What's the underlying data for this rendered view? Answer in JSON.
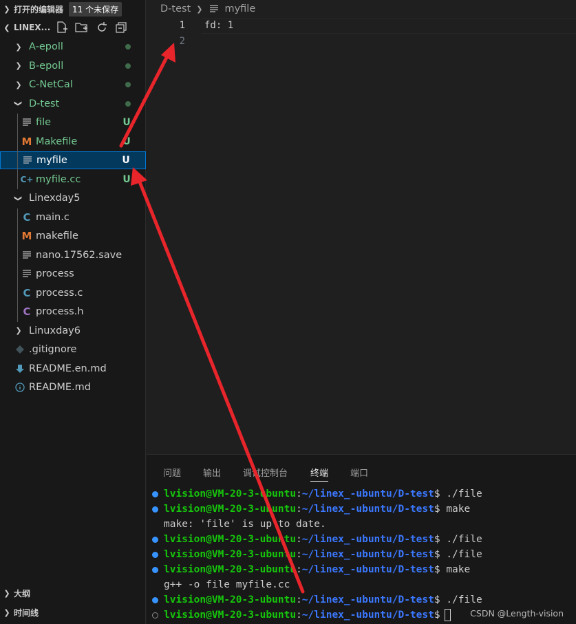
{
  "sidebar": {
    "open_editors": {
      "title": "打开的编辑器",
      "badge": "11 个未保存"
    },
    "workspace": {
      "title": "LINEX..."
    },
    "tree": [
      {
        "label": "A-epoll",
        "type": "folder",
        "status": "dot",
        "color": "#73c991"
      },
      {
        "label": "B-epoll",
        "type": "folder",
        "status": "dot",
        "color": "#73c991"
      },
      {
        "label": "C-NetCal",
        "type": "folder",
        "status": "dot",
        "color": "#73c991"
      },
      {
        "label": "D-test",
        "type": "folder-open",
        "status": "dot",
        "color": "#73c991"
      },
      {
        "label": "file",
        "type": "text-file",
        "status": "U",
        "color": "#73c991"
      },
      {
        "label": "Makefile",
        "type": "makefile",
        "status": "U",
        "color": "#73c991"
      },
      {
        "label": "myfile",
        "type": "text-file",
        "status": "U",
        "color": "#ffffff",
        "selected": true
      },
      {
        "label": "myfile.cc",
        "type": "cpp-file",
        "status": "U",
        "color": "#73c991"
      },
      {
        "label": "Linexday5",
        "type": "folder-open",
        "status": "",
        "color": "#cccccc"
      },
      {
        "label": "main.c",
        "type": "c-file",
        "status": "",
        "color": "#cccccc"
      },
      {
        "label": "makefile",
        "type": "makefile",
        "status": "",
        "color": "#cccccc"
      },
      {
        "label": "nano.17562.save",
        "type": "text-file",
        "status": "",
        "color": "#cccccc"
      },
      {
        "label": "process",
        "type": "text-file",
        "status": "",
        "color": "#cccccc"
      },
      {
        "label": "process.c",
        "type": "c-file",
        "status": "",
        "color": "#cccccc"
      },
      {
        "label": "process.h",
        "type": "h-file",
        "status": "",
        "color": "#cccccc"
      },
      {
        "label": "Linuxday6",
        "type": "folder",
        "status": "",
        "color": "#cccccc"
      },
      {
        "label": ".gitignore",
        "type": "git-file",
        "status": "",
        "color": "#cccccc"
      },
      {
        "label": "README.en.md",
        "type": "download-file",
        "status": "",
        "color": "#cccccc"
      },
      {
        "label": "README.md",
        "type": "info-file",
        "status": "",
        "color": "#cccccc"
      }
    ],
    "outline": "大纲",
    "timeline": "时间线"
  },
  "breadcrumb": {
    "folder": "D-test",
    "file": "myfile"
  },
  "editor": {
    "lines": [
      {
        "num": "1",
        "text": "fd: 1"
      },
      {
        "num": "2",
        "text": ""
      }
    ]
  },
  "panel": {
    "tabs": [
      "问题",
      "输出",
      "调试控制台",
      "终端",
      "端口"
    ],
    "active_tab": 3,
    "terminal": [
      {
        "kind": "prompt",
        "user": "lvision@VM-20-3-ubuntu",
        "path": "~/linex_-ubuntu/D-test",
        "cmd": "$ ./file"
      },
      {
        "kind": "prompt",
        "user": "lvision@VM-20-3-ubuntu",
        "path": "~/linex_-ubuntu/D-test",
        "cmd": "$ make"
      },
      {
        "kind": "output",
        "text": "make: 'file' is up to date."
      },
      {
        "kind": "prompt",
        "user": "lvision@VM-20-3-ubuntu",
        "path": "~/linex_-ubuntu/D-test",
        "cmd": "$ ./file"
      },
      {
        "kind": "prompt",
        "user": "lvision@VM-20-3-ubuntu",
        "path": "~/linex_-ubuntu/D-test",
        "cmd": "$ ./file"
      },
      {
        "kind": "prompt",
        "user": "lvision@VM-20-3-ubuntu",
        "path": "~/linex_-ubuntu/D-test",
        "cmd": "$ make"
      },
      {
        "kind": "output",
        "text": "g++ -o file myfile.cc"
      },
      {
        "kind": "prompt",
        "user": "lvision@VM-20-3-ubuntu",
        "path": "~/linex_-ubuntu/D-test",
        "cmd": "$ ./file"
      },
      {
        "kind": "prompt-current",
        "user": "lvision@VM-20-3-ubuntu",
        "path": "~/linex_-ubuntu/D-test",
        "cmd": "$"
      }
    ],
    "watermark": "CSDN @Length-vision"
  },
  "colors": {
    "annotation_arrow": "#e8252b",
    "accent": "#0078d4"
  }
}
